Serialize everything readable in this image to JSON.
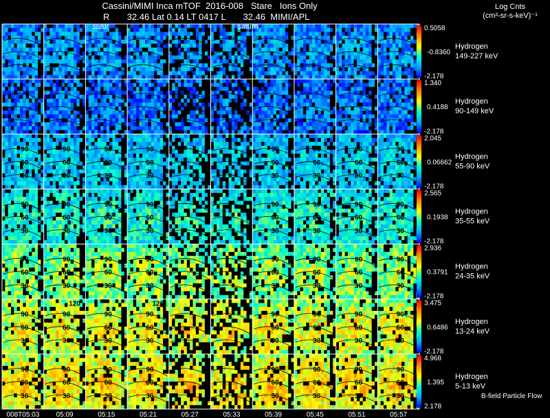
{
  "header": {
    "line1": "Cassini/MIMI Inca mTOF  2016-008   Stare   Ions Only",
    "line2": "R       32.46 Lat 0.14 LT 0417 L       32.46  MIMI/APL"
  },
  "colorbar_title": {
    "line1": "Log Cnts",
    "line2": "(cm²-sr-s-keV)⁻¹"
  },
  "planet_labels": [
    "satur",
    "saturn"
  ],
  "contour_labels": [
    "30",
    "60",
    "90",
    "120"
  ],
  "footer_label": "B-field Particle Flow",
  "colors": {
    "background": "#000000",
    "grid": "#ffffff",
    "contour": "#000000"
  },
  "chart_data": {
    "type": "heatmap",
    "time_labels": [
      "008T05:03",
      "05:09",
      "05:15",
      "05:21",
      "05:27",
      "05:33",
      "05:39",
      "05:45",
      "05:51",
      "05:57"
    ],
    "colormap": [
      "#000000",
      "#0000ff",
      "#00aaff",
      "#00ffcc",
      "#ffff00",
      "#ff8800",
      "#ff0000"
    ],
    "rows": [
      {
        "species": "Hydrogen",
        "energy": "149-227 keV",
        "cb_max": "0.5058",
        "cb_mid": "-0.8360",
        "cb_min": "-2.178",
        "level": 0.22
      },
      {
        "species": "Hydrogen",
        "energy": "90-149 keV",
        "cb_max": "1.340",
        "cb_mid": "0.4188",
        "cb_min": "-2.178",
        "level": 0.18
      },
      {
        "species": "Hydrogen",
        "energy": "55-90 keV",
        "cb_max": "2.045",
        "cb_mid": "0.06662",
        "cb_min": "-2.178",
        "level": 0.3
      },
      {
        "species": "Hydrogen",
        "energy": "35-55 keV",
        "cb_max": "2.565",
        "cb_mid": "0.1938",
        "cb_min": "-2.178",
        "level": 0.38
      },
      {
        "species": "Hydrogen",
        "energy": "24-35 keV",
        "cb_max": "2.936",
        "cb_mid": "0.3791",
        "cb_min": "-2.178",
        "level": 0.5
      },
      {
        "species": "Hydrogen",
        "energy": "13-24 keV",
        "cb_max": "3.475",
        "cb_mid": "0.6486",
        "cb_min": "-2.178",
        "level": 0.58
      },
      {
        "species": "Hydrogen",
        "energy": "5-13 keV",
        "cb_max": "4.968",
        "cb_mid": "1.395",
        "cb_min": "2.178",
        "level": 0.62
      }
    ]
  }
}
